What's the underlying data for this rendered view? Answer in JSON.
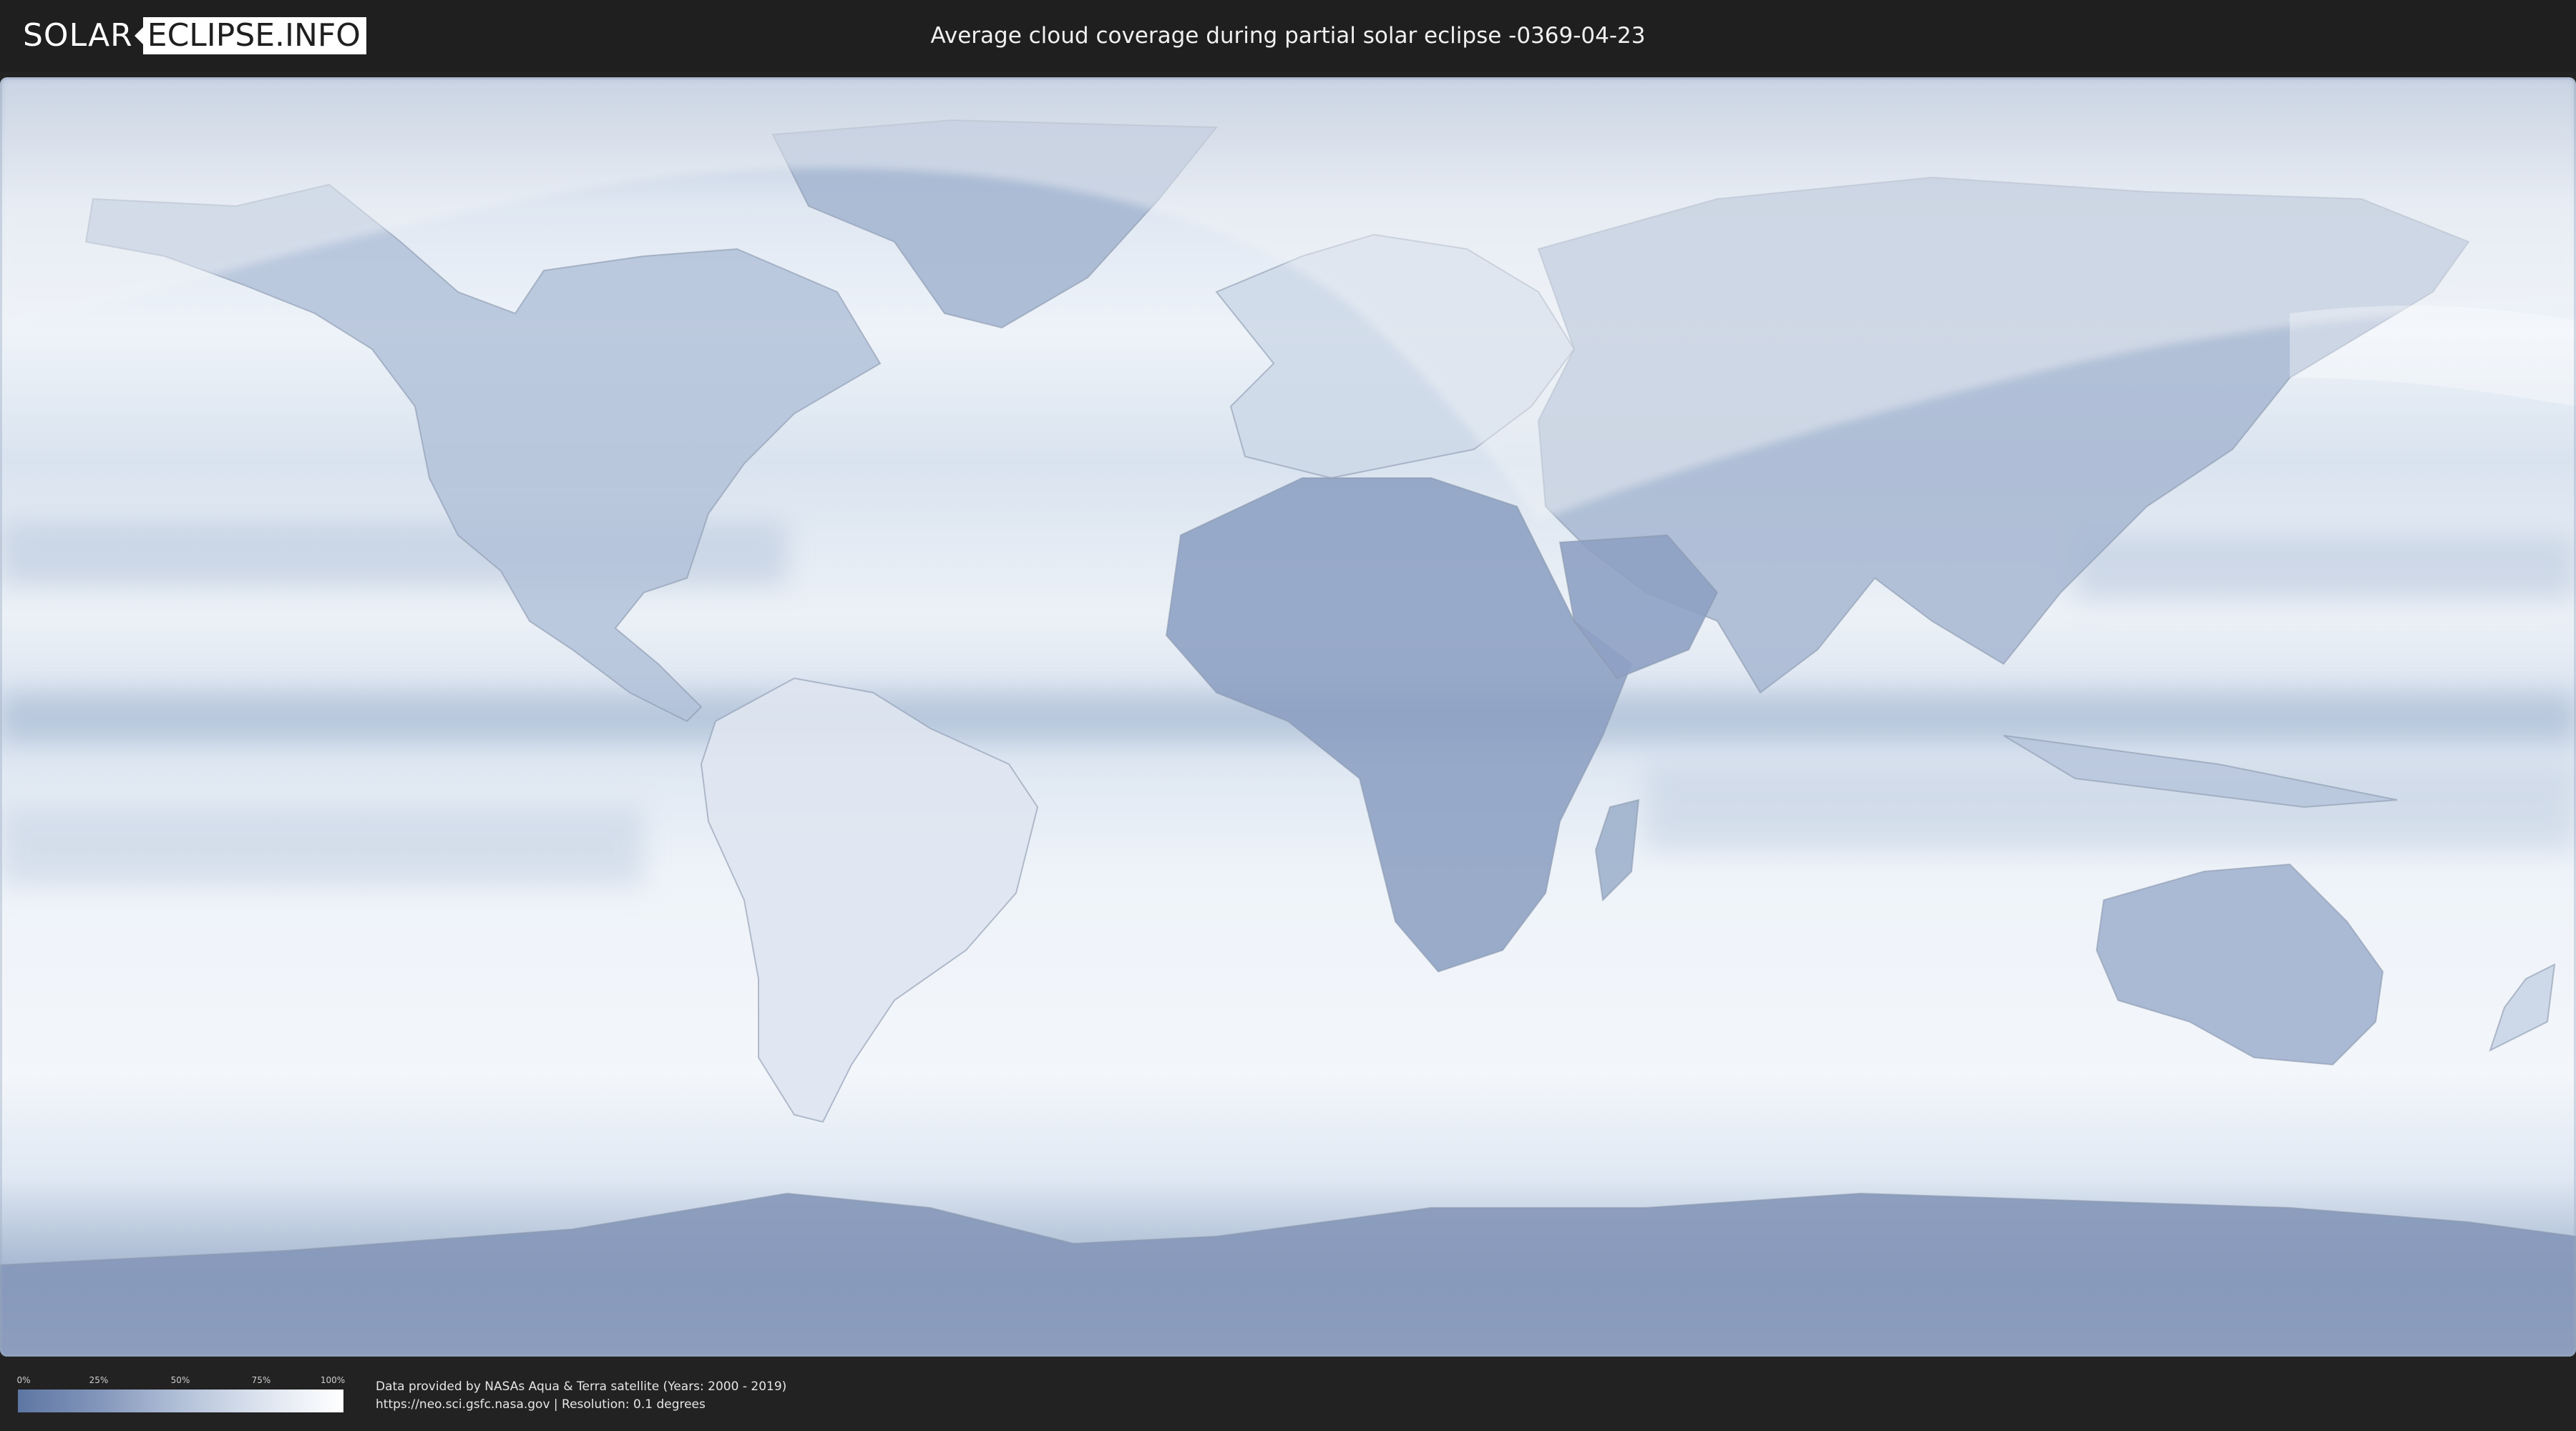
{
  "header": {
    "logo_left": "SOLAR",
    "logo_right": "ECLIPSE.INFO",
    "title": "Average cloud coverage during partial solar eclipse -0369-04-23"
  },
  "map": {
    "kind": "world cloud coverage map",
    "projection": "equirectangular",
    "low_coverage_color": "#5e76a3",
    "high_coverage_color": "#ffffff",
    "eclipse_visibility_overlay_color": "#f2f4f7"
  },
  "legend": {
    "ticks": [
      "0%",
      "25%",
      "50%",
      "75%",
      "100%"
    ]
  },
  "credits": {
    "line1": "Data provided by NASAs Aqua & Terra satellite (Years: 2000 - 2019)",
    "line2": "https://neo.sci.gsfc.nasa.gov | Resolution: 0.1 degrees"
  }
}
